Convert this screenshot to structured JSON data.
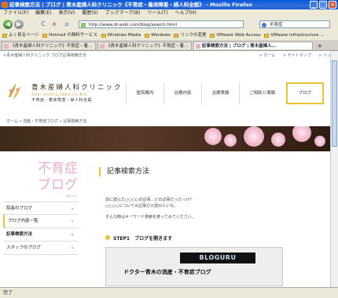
{
  "window": {
    "title": "記事検索方法 | ブログ | 青木産婦人科クリニック《不育症・着床障害・婦人科全般》 - Mozilla Firefox",
    "min": "_",
    "max": "□",
    "close": "×"
  },
  "menu": [
    "ファイル(F)",
    "編集(E)",
    "表示(V)",
    "履歴(S)",
    "ブックマーク(B)",
    "ツール(T)",
    "ヘルプ(H)"
  ],
  "nav": {
    "back": "◀",
    "forward": "▶",
    "reload": "C",
    "stop": "×",
    "home": "⌂",
    "url": "http://www.dr-aoki.com/blog/search.html",
    "search_value": "不育症"
  },
  "bookmarks": [
    "よく見るページ",
    "Hotmail の無料サービス",
    "Windows Media",
    "Windows",
    "リンクの変更",
    "VMware Web Access",
    "VMware Infrastructure ..."
  ],
  "tabs": [
    {
      "label": "《青木産婦人科クリニック》不育症・着...",
      "active": false
    },
    {
      "label": "《青木産婦人科クリニック》不育症・着...",
      "active": false
    },
    {
      "label": "記事検索方法 | ブログ | 青木産婦人...",
      "active": true
    }
  ],
  "tab_new": "+",
  "site": {
    "top_left": "<青木産婦人科クリニック ブログ記事検索方法",
    "top_links": [
      "> ホーム",
      "> サイトマップ",
      "> リンク"
    ],
    "clinic_name": "青木産婦人科クリニック",
    "clinic_roman": "AOKI SANFUJINKA CLINIC",
    "clinic_sub": "不育症・着床障害・婦人科全般",
    "gnav": [
      {
        "label": "医院案内",
        "active": false
      },
      {
        "label": "治療内容",
        "active": false
      },
      {
        "label": "治療実績",
        "active": false
      },
      {
        "label": "ご相談と情報",
        "active": false
      },
      {
        "label": "ブログ",
        "active": true
      }
    ],
    "breadcrumb": "ホーム  »  流産・不育症ブログ  »  記事検索方法",
    "side_title_1": "不育症",
    "side_title_2": "ブログ",
    "side_tag": "BLOG",
    "side_items": [
      {
        "label": "院長のブログ",
        "arrow": "»"
      },
      {
        "label": "ブログ内容一覧",
        "arrow": "»"
      },
      {
        "label": "記事検索方法",
        "arrow": "»"
      },
      {
        "label": "スタッフのブログ",
        "arrow": "»"
      }
    ],
    "page_title": "記事検索方法",
    "para1": "前に読んだ○○○○の記事…どの記事だったっけ？",
    "para2": "○○○○についての記事だけ読みたいな。",
    "para3": "そんな時はキーワード検索を使ってみてください。",
    "step1": "STEP1　ブログを開きます",
    "blog_board": "BLOGURU",
    "blog_caption": "ドクター青木の流産・不育症ブログ"
  },
  "status": "完了",
  "colors": {
    "accent_yellow": "#e8c530",
    "pink": "#e8aecb",
    "titlebar": "#0a58d8"
  }
}
